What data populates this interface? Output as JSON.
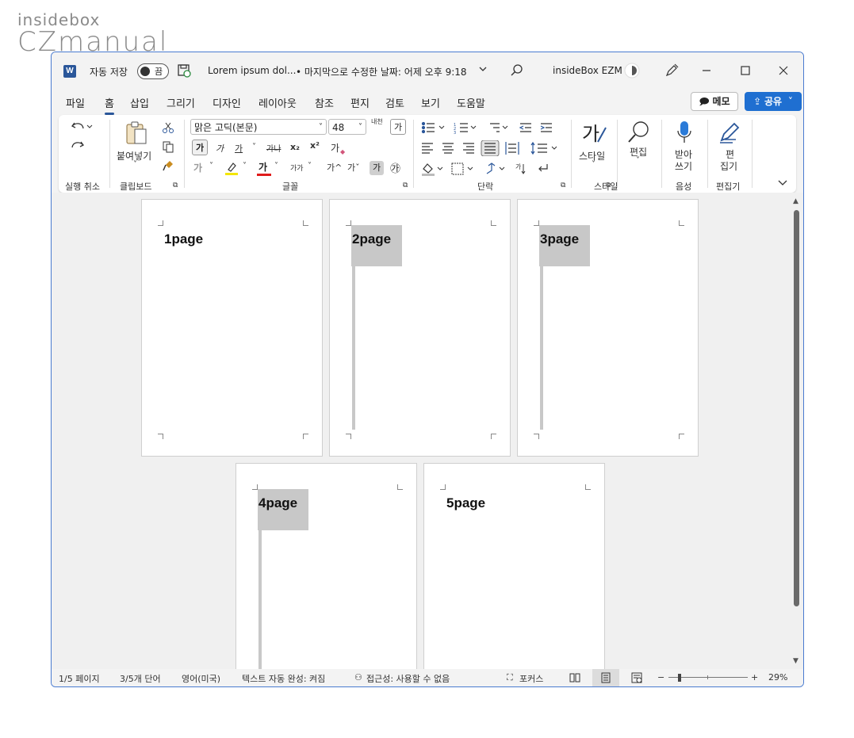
{
  "watermark": {
    "line1": "insidebox",
    "line2": "CZmanual"
  },
  "titlebar": {
    "app_icon": "W",
    "autosave_label": "자동 저장",
    "autosave_state": "끔",
    "doc_title": "Lorem ipsum dol...",
    "modified": "• 마지막으로 수정한 날짜: 어제 오후 9:18",
    "user": "insideBox EZM"
  },
  "tabs": [
    "파일",
    "홈",
    "삽입",
    "그리기",
    "디자인",
    "레이아웃",
    "참조",
    "편지",
    "검토",
    "보기",
    "도움말"
  ],
  "active_tab": "홈",
  "buttons": {
    "memo": "메모",
    "share": "공유"
  },
  "ribbon": {
    "undo_group": "실행 취소",
    "clipboard_group": "클립보드",
    "paste_label": "붙여넣기",
    "font_group": "글꼴",
    "font_name": "맑은 고딕(본문)",
    "font_size": "48",
    "paragraph_group": "단락",
    "styles_group": "스타일",
    "styles_label": "스타일",
    "editing_label": "편집",
    "voice_group": "음성",
    "dictate_label1": "받아",
    "dictate_label2": "쓰기",
    "editor_group": "편집기",
    "editor_label1": "편",
    "editor_label2": "집기",
    "font_glyphs": {
      "bold": "가",
      "italic": "가",
      "underline": "가",
      "strike": "가나",
      "sub": "x₂",
      "sup": "x²",
      "clear": "가",
      "effects": "가",
      "highlight": "가",
      "fontcolor": "가",
      "case": "가가",
      "grow": "가^",
      "shrink": "가ˇ",
      "charshade": "가",
      "enclose": "㉮",
      "phonetic": "내천",
      "border": "가"
    }
  },
  "pages": [
    {
      "label": "1page",
      "highlight": false
    },
    {
      "label": "2page",
      "highlight": true
    },
    {
      "label": "3page",
      "highlight": true
    },
    {
      "label": "4page",
      "highlight": true
    },
    {
      "label": "5page",
      "highlight": false
    }
  ],
  "status": {
    "page": "1/5 페이지",
    "words": "3/5개 단어",
    "language": "영어(미국)",
    "autocomplete": "텍스트 자동 완성: 켜짐",
    "accessibility": "접근성: 사용할 수 없음",
    "focus": "포커스",
    "zoom": "29%"
  }
}
